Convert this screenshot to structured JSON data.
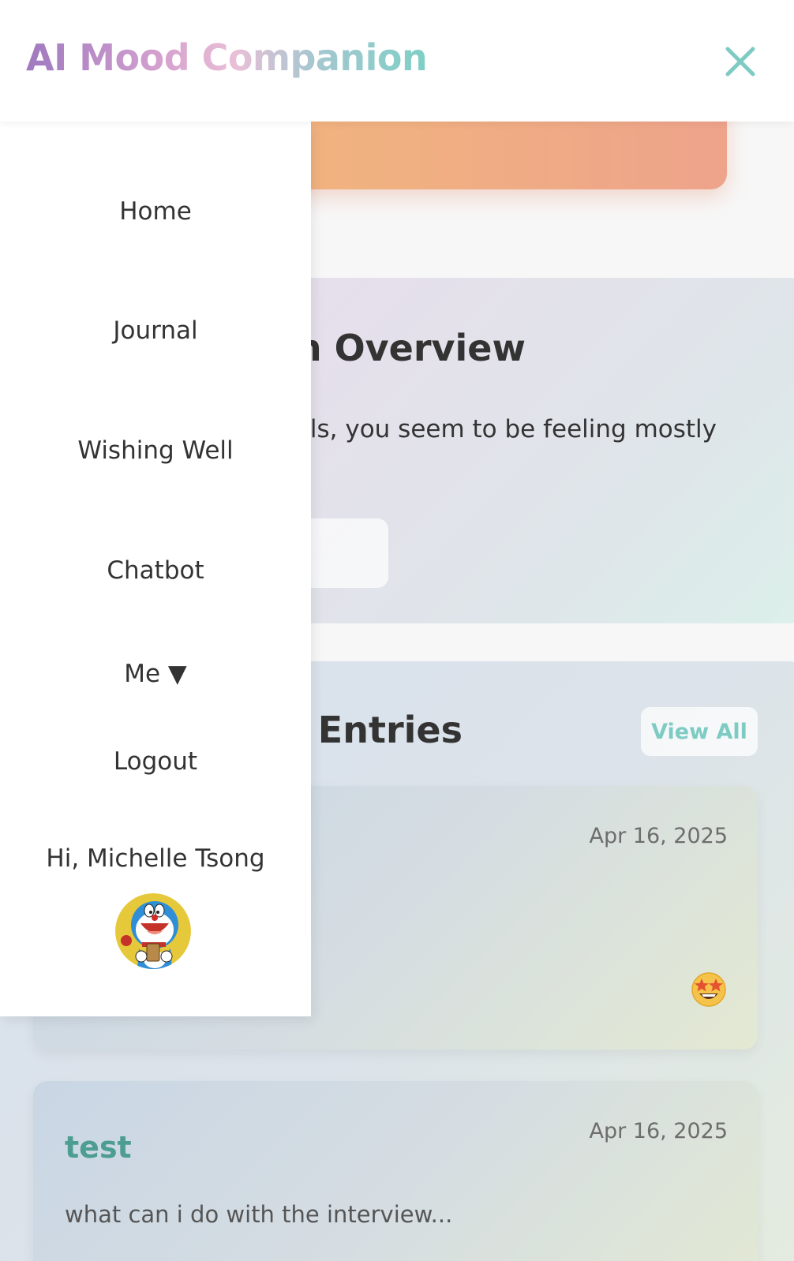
{
  "header": {
    "brand": "AI Mood Companion",
    "close_icon": "close-icon"
  },
  "drawer": {
    "items": [
      {
        "label": "Home"
      },
      {
        "label": "Journal"
      },
      {
        "label": "Wishing Well"
      },
      {
        "label": "Chatbot"
      },
      {
        "label": "Me ▼"
      },
      {
        "label": "Logout"
      }
    ],
    "greeting": "Hi, Michelle Tsong",
    "avatar_icon": "doraemon-avatar"
  },
  "overview": {
    "title_visible": "n Overview",
    "text_visible": "rnals, you seem to be feeling mostly"
  },
  "entries": {
    "title_visible": "l Entries",
    "view_all_label": "View All",
    "items": [
      {
        "date": "Apr 16, 2025",
        "emoji": "star-struck-emoji"
      },
      {
        "date": "Apr 16, 2025",
        "title": "test",
        "snippet": "what can i do with the interview..."
      }
    ]
  },
  "colors": {
    "brand_start": "#9f79bf",
    "brand_end": "#7fcfc6",
    "accent_teal": "#7ecbc4",
    "entry_title": "#4d9d93"
  }
}
